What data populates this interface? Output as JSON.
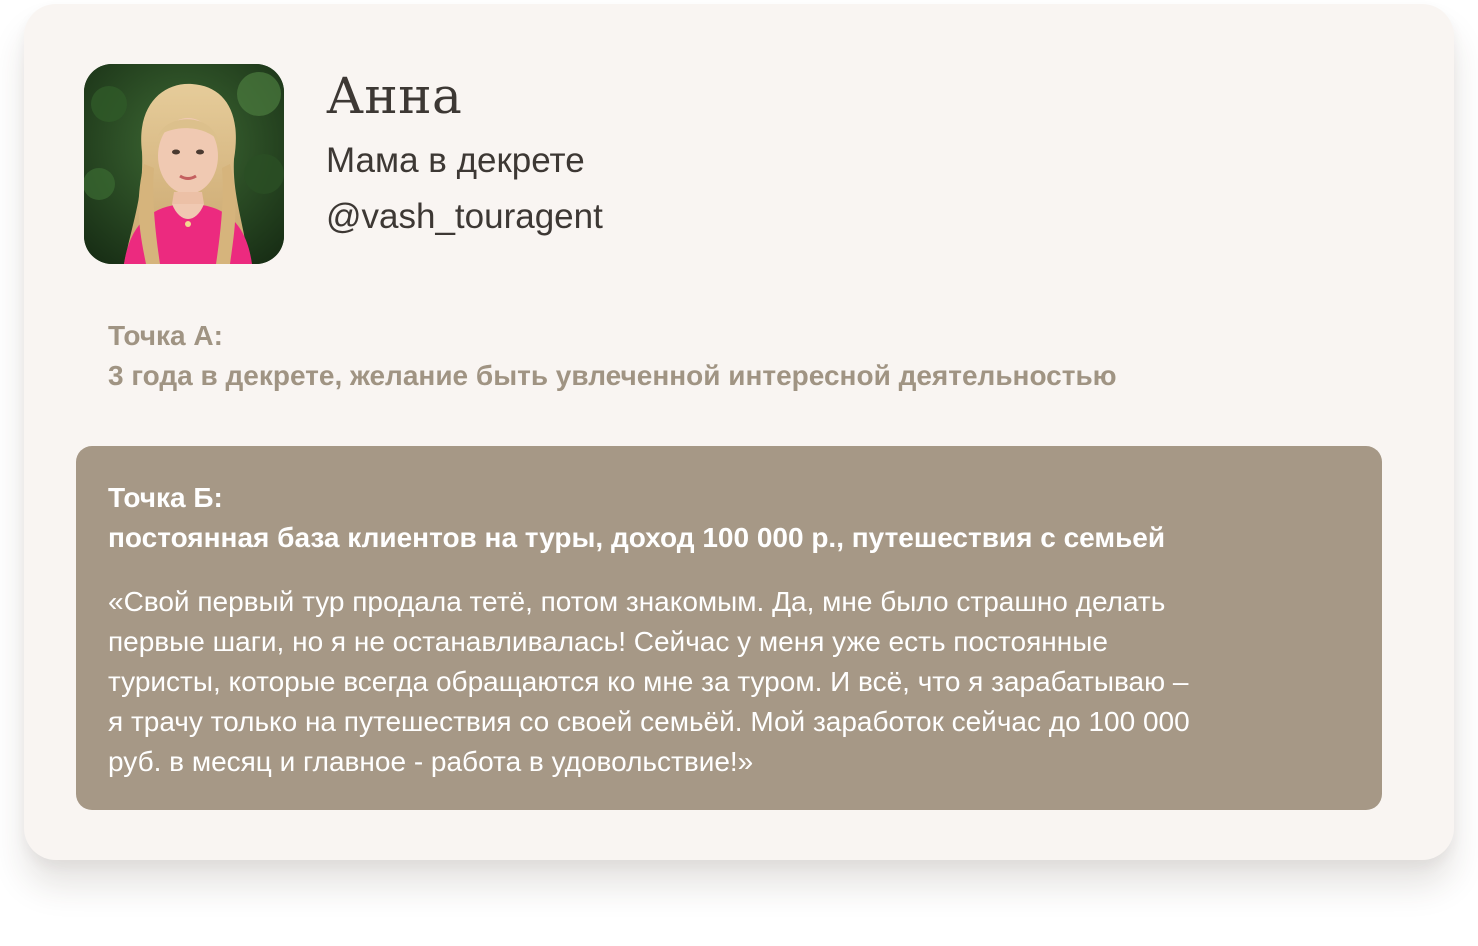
{
  "profile": {
    "name": "Анна",
    "role": "Мама в декрете",
    "handle": "@vash_touragent",
    "avatar_alt": "Анна"
  },
  "point_a": {
    "label": "Точка А:",
    "text": "3 года в декрете, желание быть увлеченной интересной деятельностью"
  },
  "point_b": {
    "label": "Точка Б:",
    "text": "постоянная база клиентов на туры, доход 100 000 р., путешествия с семьей",
    "quote_lines": [
      "«Свой первый тур продала тетё, потом знакомым. Да, мне было страшно делать",
      "первые шаги, но я не останавливалась! Сейчас у меня уже есть постоянные",
      "туристы, которые всегда обращаются ко мне за туром. И всё, что я зарабатываю –",
      "я трачу только на путешествия со своей семьёй. Мой заработок сейчас до 100 000",
      "руб. в месяц и главное - работа в удовольствие!»"
    ]
  },
  "colors": {
    "card_bg": "#f9f5f2",
    "text_dark": "#3d3834",
    "accent_muted": "#a09483",
    "box_bg": "#a69886",
    "box_text": "#ffffff"
  }
}
